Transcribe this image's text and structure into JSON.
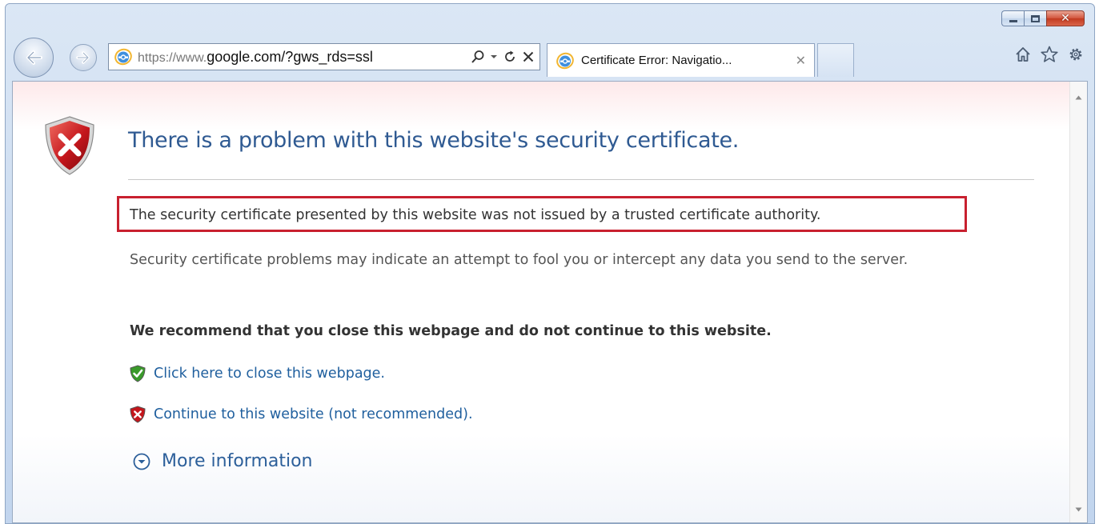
{
  "browser": {
    "address_prefix": "https://www.",
    "address_domain": "google.com/?gws_rds=ssl",
    "tab_title": "Certificate Error: Navigatio...",
    "tab_close": "✕",
    "caption_close": "✕"
  },
  "page": {
    "title": "There is a problem with this website's security certificate.",
    "highlighted_message": "The security certificate presented by this website was not issued by a trusted certificate authority.",
    "warning_text": "Security certificate problems may indicate an attempt to fool you or intercept any data you send to the server.",
    "recommendation": "We recommend that you close this webpage and do not continue to this website.",
    "close_link": "Click here to close this webpage.",
    "continue_link": "Continue to this website (not recommended).",
    "more_info": "More information"
  },
  "icons": {
    "error_shield": "shield-x-icon",
    "safe_shield": "shield-check-icon",
    "home": "home-icon",
    "favorites": "star-icon",
    "tools": "gear-icon"
  },
  "colors": {
    "title_blue": "#2f5a92",
    "link_blue": "#1f5f9e",
    "highlight_red": "#c8202f",
    "shield_red": "#c4161c",
    "shield_green": "#3a9a2a"
  }
}
